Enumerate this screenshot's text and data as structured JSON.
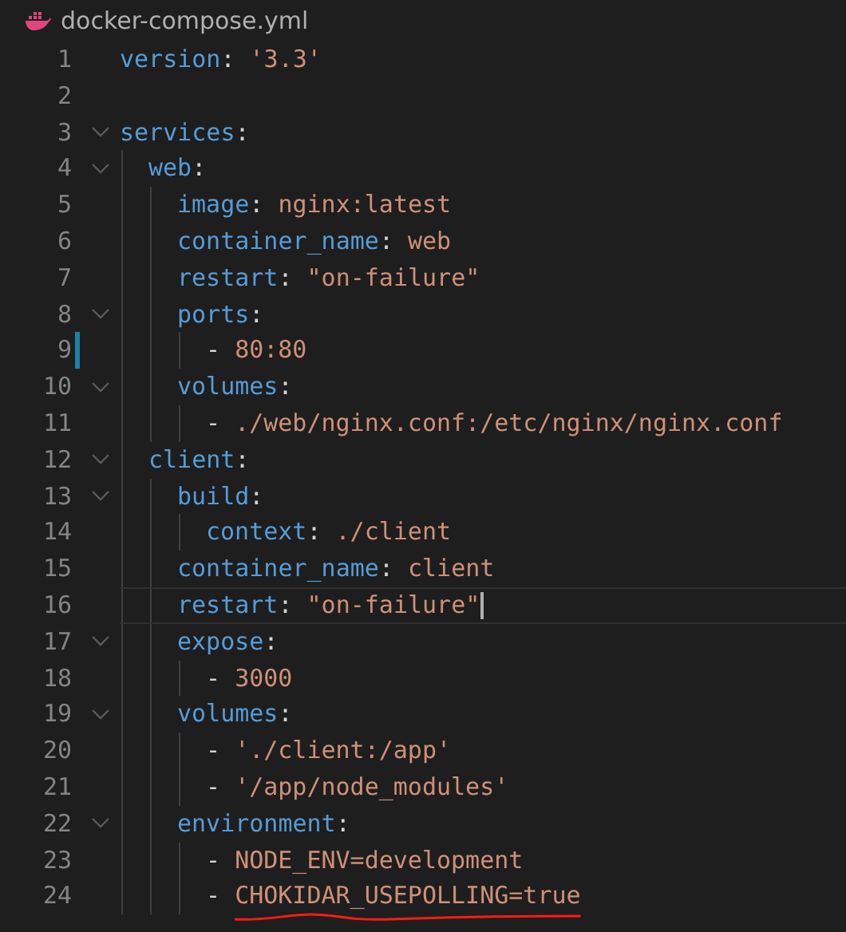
{
  "tab": {
    "title": "docker-compose.yml"
  },
  "lines": [
    {
      "number": "1",
      "tokens": [
        {
          "kind": "key",
          "text": "version"
        },
        {
          "kind": "punct",
          "text": ": "
        },
        {
          "kind": "string",
          "text": "'3.3'"
        }
      ]
    },
    {
      "number": "2"
    },
    {
      "number": "3",
      "expanded": true,
      "tokens": [
        {
          "kind": "key",
          "text": "services"
        },
        {
          "kind": "punct",
          "text": ":"
        }
      ],
      "children": [
        {
          "number": "4",
          "expanded": true,
          "tokens": [
            {
              "kind": "key",
              "text": "web"
            },
            {
              "kind": "punct",
              "text": ":"
            }
          ],
          "children": [
            {
              "number": "5",
              "tokens": [
                {
                  "kind": "key",
                  "text": "image"
                },
                {
                  "kind": "punct",
                  "text": ": "
                },
                {
                  "kind": "string",
                  "text": "nginx:latest"
                }
              ]
            },
            {
              "number": "6",
              "tokens": [
                {
                  "kind": "key",
                  "text": "container_name"
                },
                {
                  "kind": "punct",
                  "text": ": "
                },
                {
                  "kind": "string",
                  "text": "web"
                }
              ]
            },
            {
              "number": "7",
              "tokens": [
                {
                  "kind": "key",
                  "text": "restart"
                },
                {
                  "kind": "punct",
                  "text": ": "
                },
                {
                  "kind": "string",
                  "text": "\"on-failure\""
                }
              ]
            },
            {
              "number": "8",
              "expanded": true,
              "tokens": [
                {
                  "kind": "key",
                  "text": "ports"
                },
                {
                  "kind": "punct",
                  "text": ":"
                }
              ],
              "children": [
                {
                  "number": "9",
                  "modified": true,
                  "tokens": [
                    {
                      "kind": "punct",
                      "text": "- "
                    },
                    {
                      "kind": "string",
                      "text": "80:80"
                    }
                  ]
                }
              ]
            },
            {
              "number": "10",
              "expanded": true,
              "tokens": [
                {
                  "kind": "key",
                  "text": "volumes"
                },
                {
                  "kind": "punct",
                  "text": ":"
                }
              ],
              "children": [
                {
                  "number": "11",
                  "tokens": [
                    {
                      "kind": "punct",
                      "text": "- "
                    },
                    {
                      "kind": "string",
                      "text": "./web/nginx.conf:/etc/nginx/nginx.conf"
                    }
                  ]
                }
              ]
            }
          ]
        },
        {
          "number": "12",
          "expanded": true,
          "tokens": [
            {
              "kind": "key",
              "text": "client"
            },
            {
              "kind": "punct",
              "text": ":"
            }
          ],
          "children": [
            {
              "number": "13",
              "expanded": true,
              "tokens": [
                {
                  "kind": "key",
                  "text": "build"
                },
                {
                  "kind": "punct",
                  "text": ":"
                }
              ],
              "children": [
                {
                  "number": "14",
                  "tokens": [
                    {
                      "kind": "key",
                      "text": "context"
                    },
                    {
                      "kind": "punct",
                      "text": ": "
                    },
                    {
                      "kind": "string",
                      "text": "./client"
                    }
                  ]
                }
              ]
            },
            {
              "number": "15",
              "tokens": [
                {
                  "kind": "key",
                  "text": "container_name"
                },
                {
                  "kind": "punct",
                  "text": ": "
                },
                {
                  "kind": "string",
                  "text": "client"
                }
              ]
            },
            {
              "number": "16",
              "current": true,
              "tokens": [
                {
                  "kind": "key",
                  "text": "restart"
                },
                {
                  "kind": "punct",
                  "text": ": "
                },
                {
                  "kind": "string",
                  "text": "\"on-failure\""
                }
              ]
            },
            {
              "number": "17",
              "expanded": true,
              "tokens": [
                {
                  "kind": "key",
                  "text": "expose"
                },
                {
                  "kind": "punct",
                  "text": ":"
                }
              ],
              "children": [
                {
                  "number": "18",
                  "tokens": [
                    {
                      "kind": "punct",
                      "text": "- "
                    },
                    {
                      "kind": "string",
                      "text": "3000"
                    }
                  ]
                }
              ]
            },
            {
              "number": "19",
              "expanded": true,
              "tokens": [
                {
                  "kind": "key",
                  "text": "volumes"
                },
                {
                  "kind": "punct",
                  "text": ":"
                }
              ],
              "children": [
                {
                  "number": "20",
                  "tokens": [
                    {
                      "kind": "punct",
                      "text": "- "
                    },
                    {
                      "kind": "string",
                      "text": "'./client:/app'"
                    }
                  ]
                },
                {
                  "number": "21",
                  "tokens": [
                    {
                      "kind": "punct",
                      "text": "- "
                    },
                    {
                      "kind": "string",
                      "text": "'/app/node_modules'"
                    }
                  ]
                }
              ]
            },
            {
              "number": "22",
              "expanded": true,
              "tokens": [
                {
                  "kind": "key",
                  "text": "environment"
                },
                {
                  "kind": "punct",
                  "text": ":"
                }
              ],
              "children": [
                {
                  "number": "23",
                  "tokens": [
                    {
                      "kind": "punct",
                      "text": "- "
                    },
                    {
                      "kind": "string",
                      "text": "NODE_ENV=development"
                    }
                  ]
                },
                {
                  "number": "24",
                  "tokens": [
                    {
                      "kind": "punct",
                      "text": "- "
                    },
                    {
                      "kind": "string",
                      "text": "CHOKIDAR_USEPOLLING=true",
                      "underlined": true
                    }
                  ]
                }
              ]
            }
          ]
        }
      ]
    }
  ]
}
